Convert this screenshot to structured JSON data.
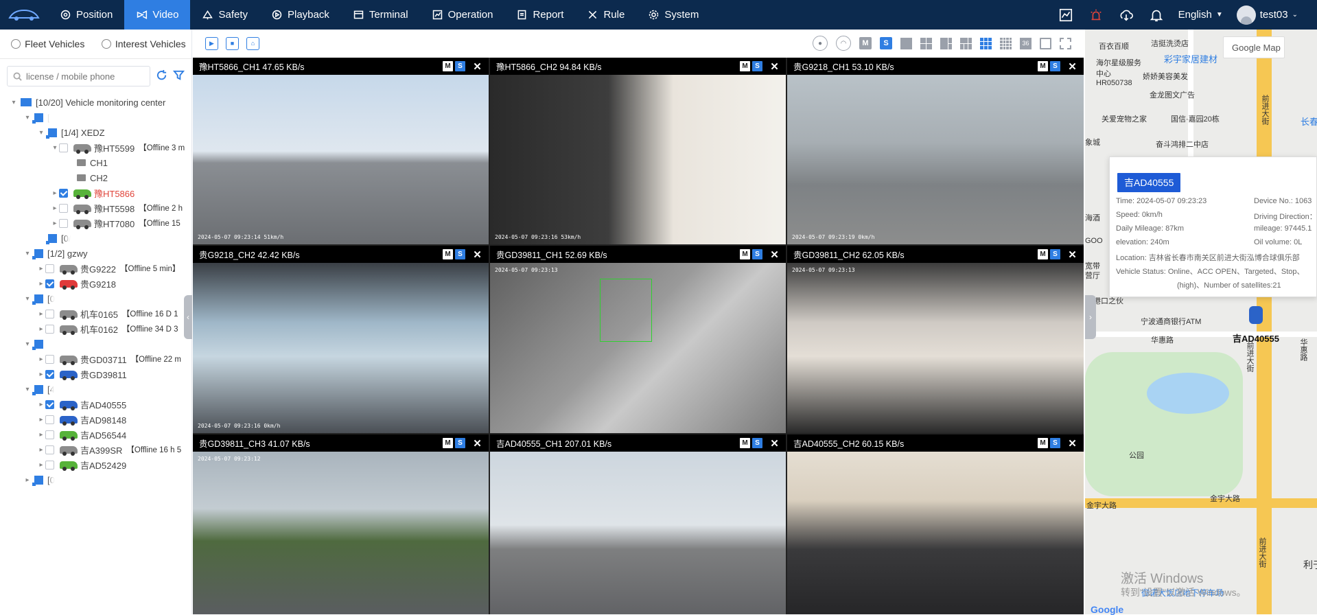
{
  "nav": {
    "items": [
      {
        "label": "Position",
        "icon": "position-icon"
      },
      {
        "label": "Video",
        "icon": "video-icon",
        "active": true
      },
      {
        "label": "Safety",
        "icon": "safety-icon"
      },
      {
        "label": "Playback",
        "icon": "playback-icon"
      },
      {
        "label": "Terminal",
        "icon": "terminal-icon"
      },
      {
        "label": "Operation",
        "icon": "operation-icon"
      },
      {
        "label": "Report",
        "icon": "report-icon"
      },
      {
        "label": "Rule",
        "icon": "rule-icon"
      },
      {
        "label": "System",
        "icon": "system-icon"
      }
    ],
    "language": "English",
    "user": "test03"
  },
  "sidebar": {
    "tabs": [
      "Fleet Vehicles",
      "Interest Vehicles"
    ],
    "search_placeholder": "license / mobile phone",
    "tree": {
      "root": "[10/20] Vehicle monitoring center",
      "group1_prefix": "[",
      "group_xedz": "[1/4] XEDZ",
      "v1": {
        "plate": "豫HT5599",
        "status": "【Offline 3 m"
      },
      "ch1": "CH1",
      "ch2": "CH2",
      "v2": {
        "plate": "豫HT5866"
      },
      "v3": {
        "plate": "豫HT5598",
        "status": "【Offline 2 h"
      },
      "v4": {
        "plate": "豫HT7080",
        "status": "【Offline 15"
      },
      "group_0": "[0/",
      "group_gzwy": "[1/2] gzwy",
      "v5": {
        "plate": "贵G9222",
        "status": "【Offline 5 min】"
      },
      "v6": {
        "plate": "贵G9218"
      },
      "group_0b": "[0",
      "v7": {
        "plate": "机车0165",
        "status": "【Offline 16 D 1"
      },
      "v8": {
        "plate": "机车0162",
        "status": "【Offline 34 D 3"
      },
      "v9": {
        "plate": "贵GD03711",
        "status": "【Offline 22 m"
      },
      "v10": {
        "plate": "贵GD39811"
      },
      "group_4": "[4",
      "v11": {
        "plate": "吉AD40555"
      },
      "v12": {
        "plate": "吉AD98148"
      },
      "v13": {
        "plate": "吉AD56544"
      },
      "v14": {
        "plate": "吉A399SR",
        "status": "【Offline 16 h 5"
      },
      "v15": {
        "plate": "吉AD52429"
      },
      "group_last": "[0"
    }
  },
  "toolbar": {
    "m_label": "M",
    "s_label": "S",
    "num_label": "36"
  },
  "videos": [
    {
      "title": "豫HT5866_CH1 47.65 KB/s",
      "stamp": "2024-05-07 09:23:14  51km/h"
    },
    {
      "title": "豫HT5866_CH2 94.84 KB/s",
      "stamp": "2024-05-07 09:23:16  53km/h"
    },
    {
      "title": "贵G9218_CH1 53.10 KB/s",
      "stamp": "2024-05-07 09:23:19  0km/h"
    },
    {
      "title": "贵G9218_CH2 42.42 KB/s",
      "stamp": "2024-05-07 09:23:16  0km/h"
    },
    {
      "title": "贵GD39811_CH1 52.69 KB/s",
      "stamp": "2024-05-07 09:23:13"
    },
    {
      "title": "贵GD39811_CH2 62.05 KB/s",
      "stamp": "2024-05-07 09:23:13"
    },
    {
      "title": "贵GD39811_CH3 41.07 KB/s",
      "stamp": "2024-05-07 09:23:12"
    },
    {
      "title": "吉AD40555_CH1 207.01 KB/s",
      "stamp": ""
    },
    {
      "title": "吉AD40555_CH2 60.15 KB/s",
      "stamp": ""
    }
  ],
  "badges": {
    "m": "M",
    "s": "S",
    "close": "✕"
  },
  "map": {
    "type": "Google Map",
    "labels": [
      "百衣百顺",
      "洁挺洗烫店",
      "海尔星级服务中心HR050738",
      "彩宇家居建材",
      "中",
      "娇娇美容美发",
      "金龙图文广告",
      "关爱宠物之家",
      "国信·嘉园20栋",
      "奋斗鸿排二中店",
      "象城",
      "海酒",
      "GOO",
      "宽带",
      "营厅",
      "港口之伙",
      "宁波通商银行ATM",
      "华惠路",
      "公园",
      "金宇大路",
      "金宇大路",
      "前进大街",
      "前进大街",
      "前进大街",
      "长春",
      "华惠路",
      "利于"
    ],
    "vehicle_label": "吉AD40555",
    "watermark1": "激活 Windows",
    "watermark2": "转到\"设置\"以激活 Windows。",
    "poi": "御诺大饭店地下停车场",
    "google": "Google"
  },
  "popup": {
    "plate": "吉AD40555",
    "time": "Time:  2024-05-07 09:23:23",
    "device": "Device No.:  1063",
    "speed": "Speed:  0km/h",
    "direction": "Driving Direction：",
    "daily": "Daily Mileage:  87km",
    "mileage": "mileage:  97445.1",
    "elevation": "elevation:  240m",
    "oil": "Oil volume:  0L",
    "location": "Location:  吉林省长春市南关区前进大街泓博合球俱乐部",
    "status1": "Vehicle Status:  Online、ACC OPEN、Targeted、Stop、",
    "status2": "(high)、Number of satellites:21"
  },
  "colors": {
    "nav_bg": "#0c2a4e",
    "accent": "#2f7ee2",
    "alert_red": "#e0443a"
  }
}
